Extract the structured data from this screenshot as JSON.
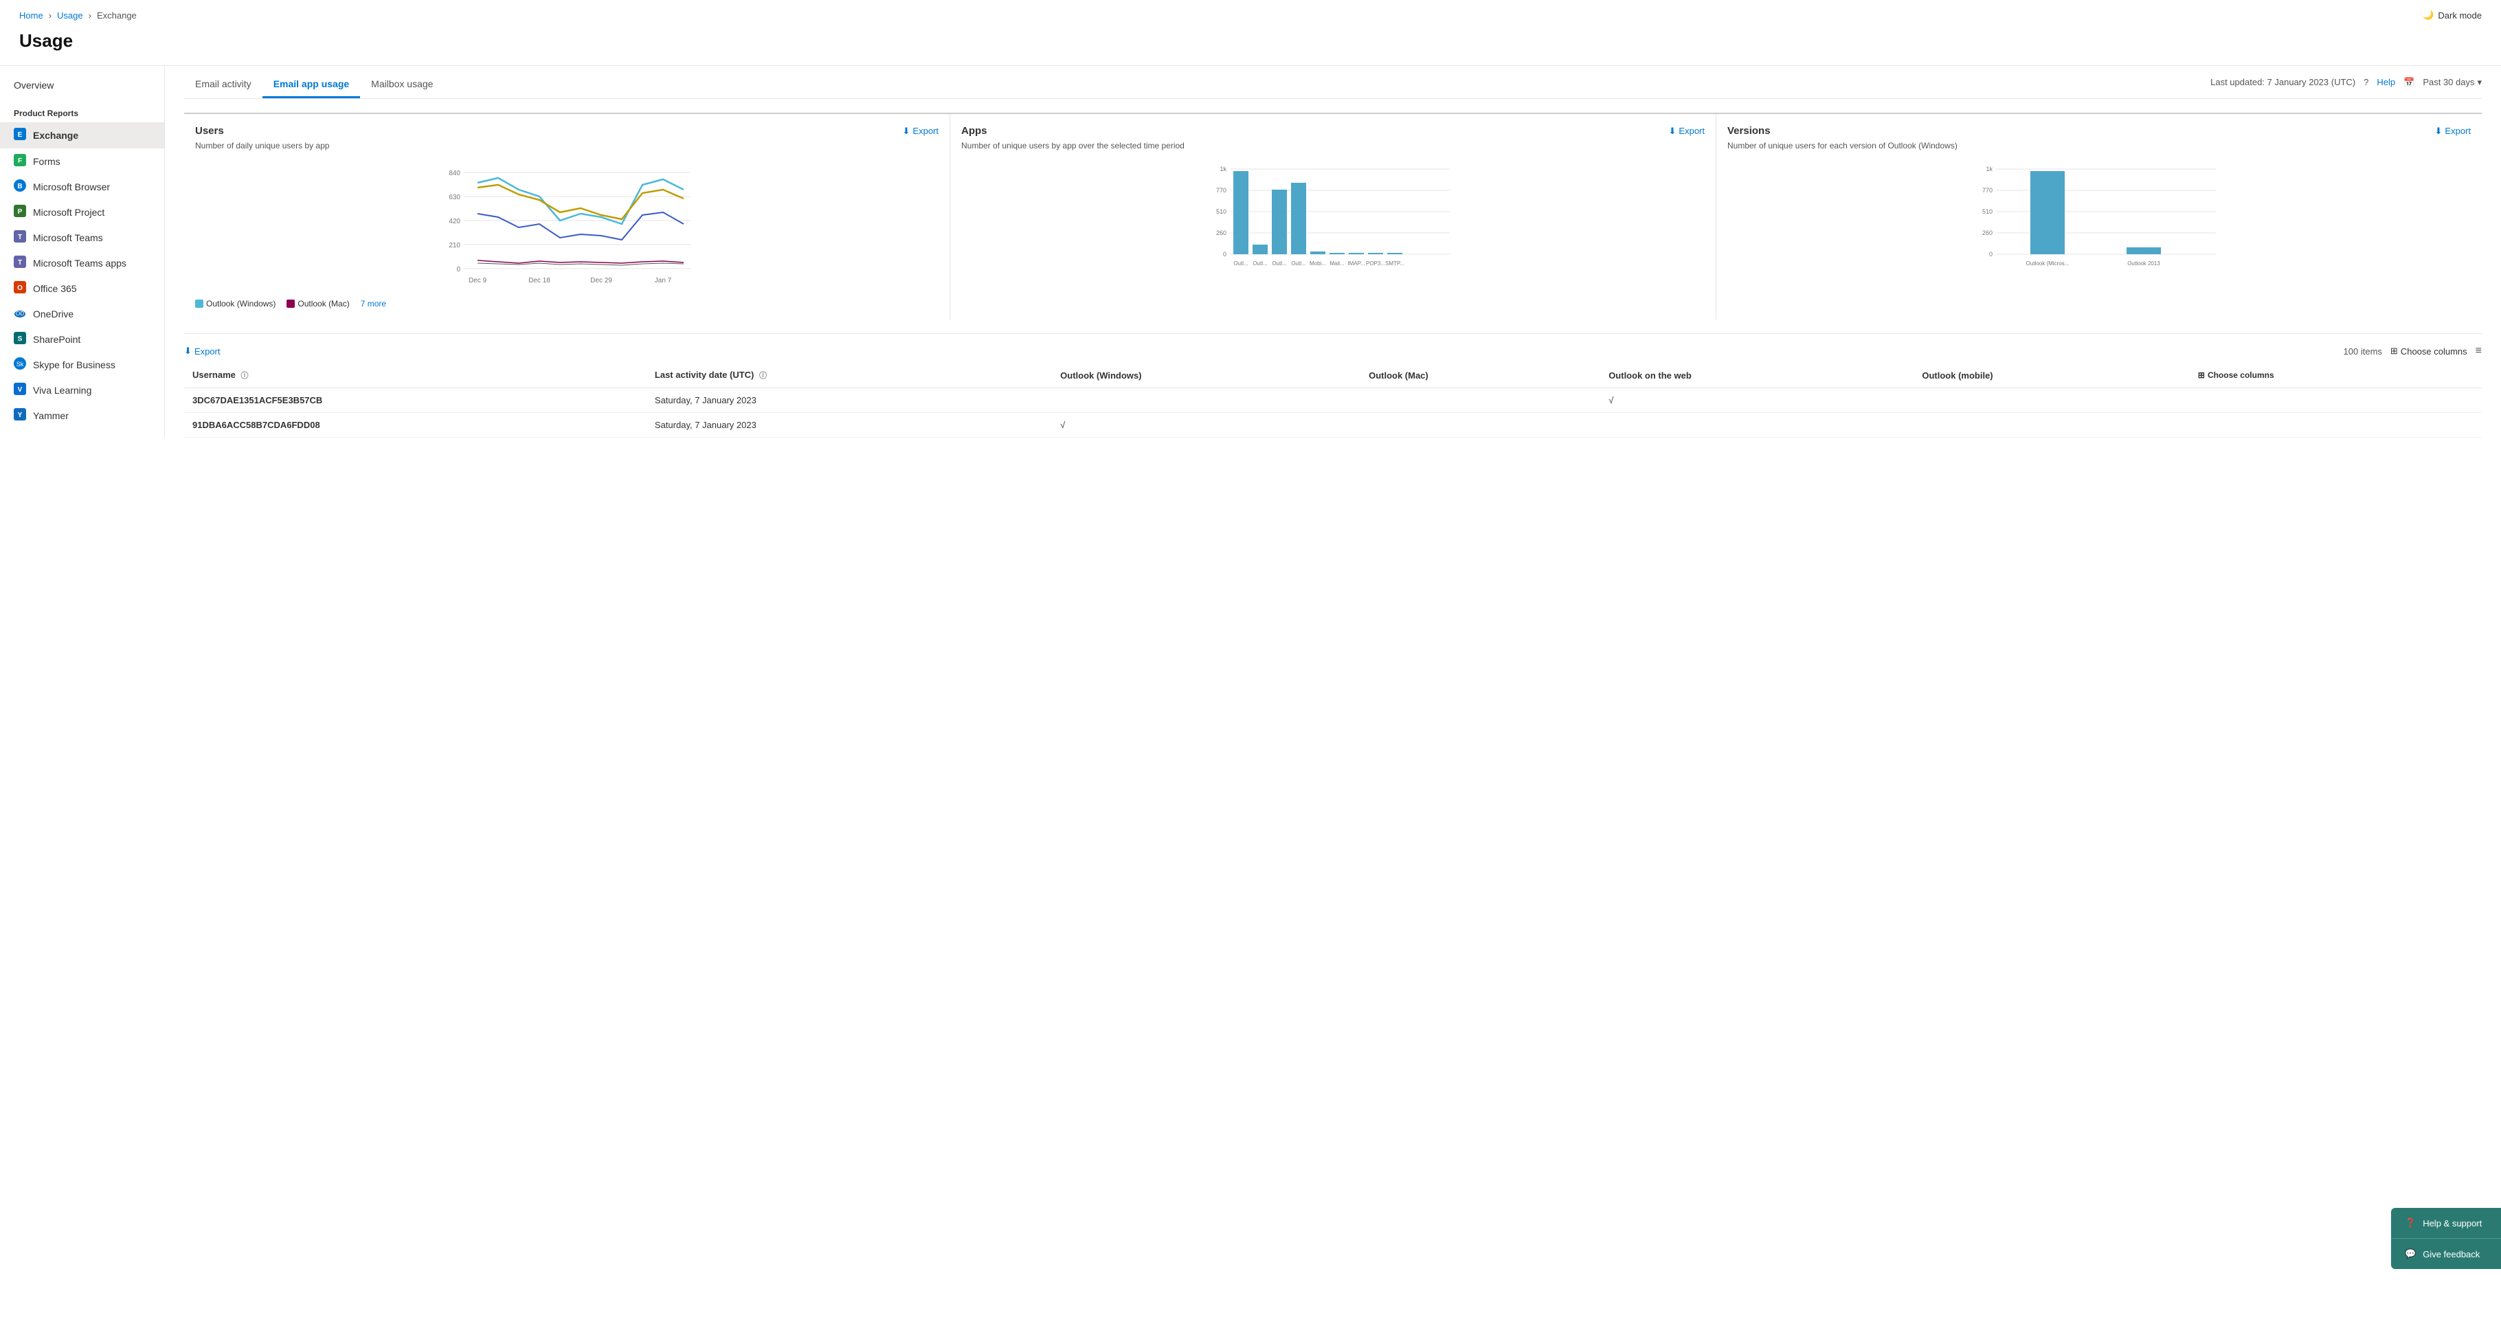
{
  "breadcrumb": {
    "home": "Home",
    "usage": "Usage",
    "current": "Exchange"
  },
  "darkmode": {
    "label": "Dark mode"
  },
  "pageTitle": "Usage",
  "sidebar": {
    "overviewLabel": "Overview",
    "sectionLabel": "Product Reports",
    "items": [
      {
        "id": "exchange",
        "label": "Exchange",
        "icon": "🔷",
        "active": true
      },
      {
        "id": "forms",
        "label": "Forms",
        "icon": "🟩",
        "active": false
      },
      {
        "id": "microsoft-browser",
        "label": "Microsoft Browser",
        "icon": "🌐",
        "active": false
      },
      {
        "id": "microsoft-project",
        "label": "Microsoft Project",
        "icon": "🟧",
        "active": false
      },
      {
        "id": "microsoft-teams",
        "label": "Microsoft Teams",
        "icon": "🟪",
        "active": false
      },
      {
        "id": "microsoft-teams-apps",
        "label": "Microsoft Teams apps",
        "icon": "🟪",
        "active": false
      },
      {
        "id": "office-365",
        "label": "Office 365",
        "icon": "🔴",
        "active": false
      },
      {
        "id": "onedrive",
        "label": "OneDrive",
        "icon": "☁️",
        "active": false
      },
      {
        "id": "sharepoint",
        "label": "SharePoint",
        "icon": "🔵",
        "active": false
      },
      {
        "id": "skype-for-business",
        "label": "Skype for Business",
        "icon": "🔵",
        "active": false
      },
      {
        "id": "viva-learning",
        "label": "Viva Learning",
        "icon": "📘",
        "active": false
      },
      {
        "id": "yammer",
        "label": "Yammer",
        "icon": "🟡",
        "active": false
      }
    ]
  },
  "tabs": [
    {
      "id": "email-activity",
      "label": "Email activity",
      "active": false
    },
    {
      "id": "email-app-usage",
      "label": "Email app usage",
      "active": true
    },
    {
      "id": "mailbox-usage",
      "label": "Mailbox usage",
      "active": false
    }
  ],
  "tabMeta": {
    "lastUpdated": "Last updated: 7 January 2023 (UTC)",
    "helpLabel": "Help",
    "dateRange": "Past 30 days"
  },
  "charts": {
    "users": {
      "title": "Users",
      "exportLabel": "Export",
      "subtitle": "Number of daily unique users by app",
      "legend": [
        {
          "label": "Outlook (Windows)",
          "color": "#4db8d9"
        },
        {
          "label": "Outlook (Mac)",
          "color": "#8b0050"
        },
        {
          "label": "7 more",
          "color": null
        }
      ],
      "xLabels": [
        "Dec 9",
        "Dec 18",
        "Dec 29",
        "Jan 7"
      ],
      "yLabels": [
        "840",
        "630",
        "420",
        "210",
        "0"
      ]
    },
    "apps": {
      "title": "Apps",
      "exportLabel": "Export",
      "subtitle": "Number of unique users by app over the selected time period",
      "bars": [
        {
          "label": "Outl...",
          "value": 980
        },
        {
          "label": "Outl...",
          "value": 110
        },
        {
          "label": "Outl...",
          "value": 760
        },
        {
          "label": "Outl...",
          "value": 840
        },
        {
          "label": "Mobi...",
          "value": 30
        },
        {
          "label": "Mail...",
          "value": 10
        },
        {
          "label": "IMAP...",
          "value": 10
        },
        {
          "label": "POP3...",
          "value": 10
        },
        {
          "label": "SMTP...",
          "value": 10
        }
      ],
      "yLabels": [
        "1k",
        "770",
        "510",
        "260",
        "0"
      ]
    },
    "versions": {
      "title": "Versions",
      "exportLabel": "Export",
      "subtitle": "Number of unique users for each version of Outlook (Windows)",
      "bars": [
        {
          "label": "Outlook (Micros...",
          "value": 980
        },
        {
          "label": "Outlook 2013",
          "value": 80
        }
      ],
      "yLabels": [
        "1k",
        "770",
        "510",
        "260",
        "0"
      ]
    }
  },
  "table": {
    "exportLabel": "Export",
    "itemCount": "100 items",
    "chooseColumnsLabel": "Choose columns",
    "columns": [
      {
        "id": "username",
        "label": "Username",
        "hasInfo": true
      },
      {
        "id": "last-activity",
        "label": "Last activity date (UTC)",
        "hasInfo": true
      },
      {
        "id": "outlook-windows",
        "label": "Outlook (Windows)"
      },
      {
        "id": "outlook-mac",
        "label": "Outlook (Mac)"
      },
      {
        "id": "outlook-web",
        "label": "Outlook on the web"
      },
      {
        "id": "outlook-mobile",
        "label": "Outlook (mobile)"
      }
    ],
    "rows": [
      {
        "username": "3DC67DAE1351ACF5E3B57CB",
        "lastActivity": "Saturday, 7 January 2023",
        "outlookWindows": "",
        "outlookMac": "",
        "outlookWeb": "√",
        "outlookMobile": ""
      },
      {
        "username": "91DBA6ACC58B7CDA6FDD08",
        "lastActivity": "Saturday, 7 January 2023",
        "outlookWindows": "√",
        "outlookMac": "",
        "outlookWeb": "",
        "outlookMobile": ""
      }
    ]
  },
  "floatingPanel": {
    "items": [
      {
        "id": "help-support",
        "label": "Help & support",
        "icon": "?"
      },
      {
        "id": "give-feedback",
        "label": "Give feedback",
        "icon": "💬"
      }
    ]
  }
}
